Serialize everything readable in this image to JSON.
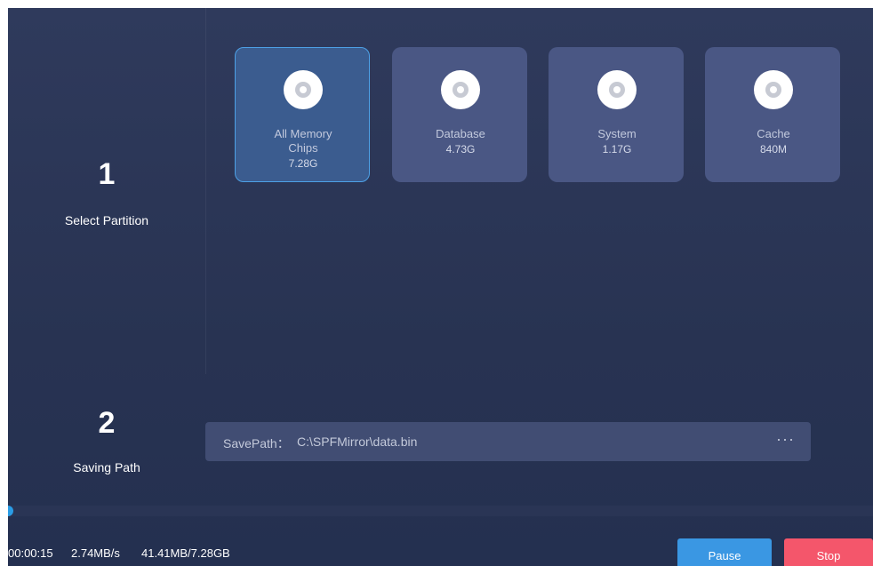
{
  "steps": {
    "select_partition": {
      "number": "1",
      "label": "Select Partition"
    },
    "saving_path": {
      "number": "2",
      "label": "Saving Path"
    }
  },
  "partitions": [
    {
      "name_line1": "All Memory",
      "name_line2": "Chips",
      "size": "7.28G",
      "selected": true,
      "icon": "disc-icon"
    },
    {
      "name_line1": "Database",
      "name_line2": "",
      "size": "4.73G",
      "selected": false,
      "icon": "disc-icon"
    },
    {
      "name_line1": "System",
      "name_line2": "",
      "size": "1.17G",
      "selected": false,
      "icon": "disc-icon"
    },
    {
      "name_line1": "Cache",
      "name_line2": "",
      "size": "840M",
      "selected": false,
      "icon": "disc-icon"
    }
  ],
  "save_path": {
    "prefix": "SavePath：",
    "value": "C:\\SPFMirror\\data.bin",
    "browse_label": "···"
  },
  "progress": {
    "fraction": 0.006
  },
  "status": {
    "elapsed": "00:00:15",
    "speed": "2.74MB/s",
    "transferred": "41.41MB/7.28GB"
  },
  "buttons": {
    "pause_label": "Pause",
    "stop_label": "Stop"
  },
  "colors": {
    "accent": "#3a97e3",
    "danger": "#f4566b",
    "selected_border": "#4da0e6"
  }
}
